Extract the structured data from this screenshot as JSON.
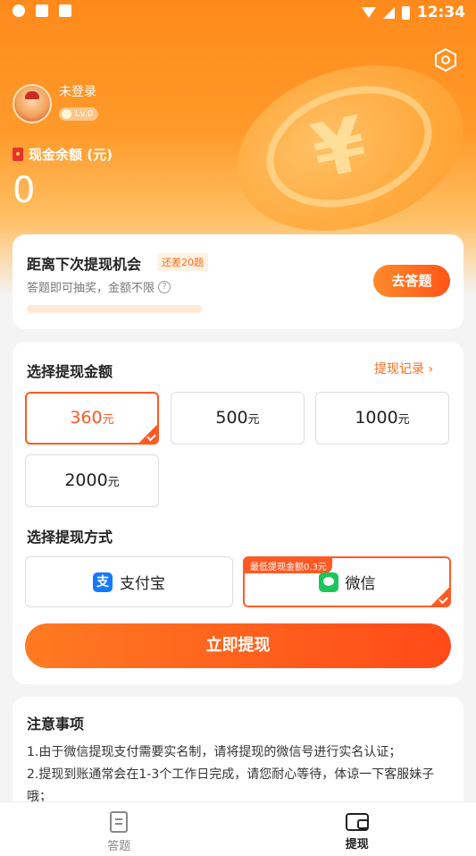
{
  "status_bar": {
    "time": "12:34"
  },
  "user": {
    "name": "未登录",
    "level": "Lv.0"
  },
  "balance": {
    "label": "现金余额 (元)",
    "value": "0"
  },
  "next_chance": {
    "title": "距离下次提现机会",
    "badge": "还差20题",
    "subtitle": "答题即可抽奖，金额不限",
    "progress": 0.0,
    "button": "去答题"
  },
  "withdraw": {
    "amount_title": "选择提现金额",
    "history_link": "提现记录",
    "unit": "元",
    "amounts": [
      "360",
      "500",
      "1000",
      "2000"
    ],
    "selected_amount": "360",
    "method_title": "选择提现方式",
    "methods": [
      {
        "label": "支付宝",
        "icon": "alipay-icon"
      },
      {
        "label": "微信",
        "icon": "wechat-icon",
        "tag": "最低提现金额0.3元"
      }
    ],
    "selected_method": "微信",
    "submit": "立即提现"
  },
  "notes": {
    "title": "注意事项",
    "items": [
      "1.由于微信提现支付需要实名制，请将提现的微信号进行实名认证；",
      "2.提现到账通常会在1-3个工作日完成，请您耐心等待，体谅一下客服妹子哦；"
    ]
  },
  "bottom_nav": [
    {
      "label": "答题",
      "icon": "document-icon",
      "active": false
    },
    {
      "label": "提现",
      "icon": "wallet-icon",
      "active": true
    }
  ],
  "colors": {
    "accent": "#ff5a24",
    "header": "#ff8a1c"
  }
}
